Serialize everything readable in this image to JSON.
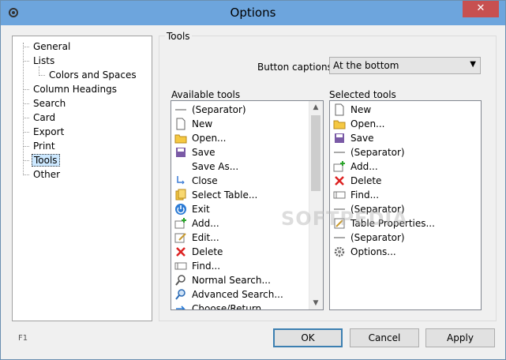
{
  "window": {
    "title": "Options",
    "close_glyph": "✕"
  },
  "nav": {
    "items": [
      {
        "label": "General"
      },
      {
        "label": "Lists"
      },
      {
        "label": "Colors and Spaces"
      },
      {
        "label": "Column Headings"
      },
      {
        "label": "Search"
      },
      {
        "label": "Card"
      },
      {
        "label": "Export"
      },
      {
        "label": "Print"
      },
      {
        "label": "Tools",
        "selected": true
      },
      {
        "label": "Other"
      }
    ]
  },
  "tools": {
    "group_title": "Tools",
    "button_captions_label": "Button captions",
    "button_captions_value": "At the bottom",
    "available_label": "Available tools",
    "selected_label": "Selected tools",
    "available": [
      {
        "icon": "separator-icon",
        "label": "(Separator)"
      },
      {
        "icon": "new-document-icon",
        "label": "New"
      },
      {
        "icon": "folder-open-icon",
        "label": "Open..."
      },
      {
        "icon": "floppy-disk-icon",
        "label": "Save"
      },
      {
        "icon": "blank-icon",
        "label": "Save As..."
      },
      {
        "icon": "close-document-icon",
        "label": "Close"
      },
      {
        "icon": "select-table-icon",
        "label": "Select Table..."
      },
      {
        "icon": "power-icon",
        "label": "Exit"
      },
      {
        "icon": "add-record-icon",
        "label": "Add..."
      },
      {
        "icon": "edit-record-icon",
        "label": "Edit..."
      },
      {
        "icon": "delete-x-icon",
        "label": "Delete"
      },
      {
        "icon": "find-icon",
        "label": "Find..."
      },
      {
        "icon": "magnifier-icon",
        "label": "Normal Search..."
      },
      {
        "icon": "advanced-search-icon",
        "label": "Advanced Search..."
      },
      {
        "icon": "choose-return-icon",
        "label": "Choose/Return"
      }
    ],
    "selected": [
      {
        "icon": "new-document-icon",
        "label": "New"
      },
      {
        "icon": "folder-open-icon",
        "label": "Open..."
      },
      {
        "icon": "floppy-disk-icon",
        "label": "Save"
      },
      {
        "icon": "separator-icon",
        "label": "(Separator)"
      },
      {
        "icon": "add-record-icon",
        "label": "Add..."
      },
      {
        "icon": "delete-x-icon",
        "label": "Delete"
      },
      {
        "icon": "find-icon",
        "label": "Find..."
      },
      {
        "icon": "separator-icon",
        "label": "(Separator)"
      },
      {
        "icon": "table-properties-icon",
        "label": "Table Properties..."
      },
      {
        "icon": "separator-icon",
        "label": "(Separator)"
      },
      {
        "icon": "gear-icon",
        "label": "Options..."
      }
    ]
  },
  "footer": {
    "help_key": "F1",
    "ok_label": "OK",
    "cancel_label": "Cancel",
    "apply_label": "Apply"
  },
  "watermark": "SOFTPEDIA",
  "colors": {
    "titlebar": "#6da5dd",
    "close": "#c75050",
    "selection": "#cce8ff"
  }
}
